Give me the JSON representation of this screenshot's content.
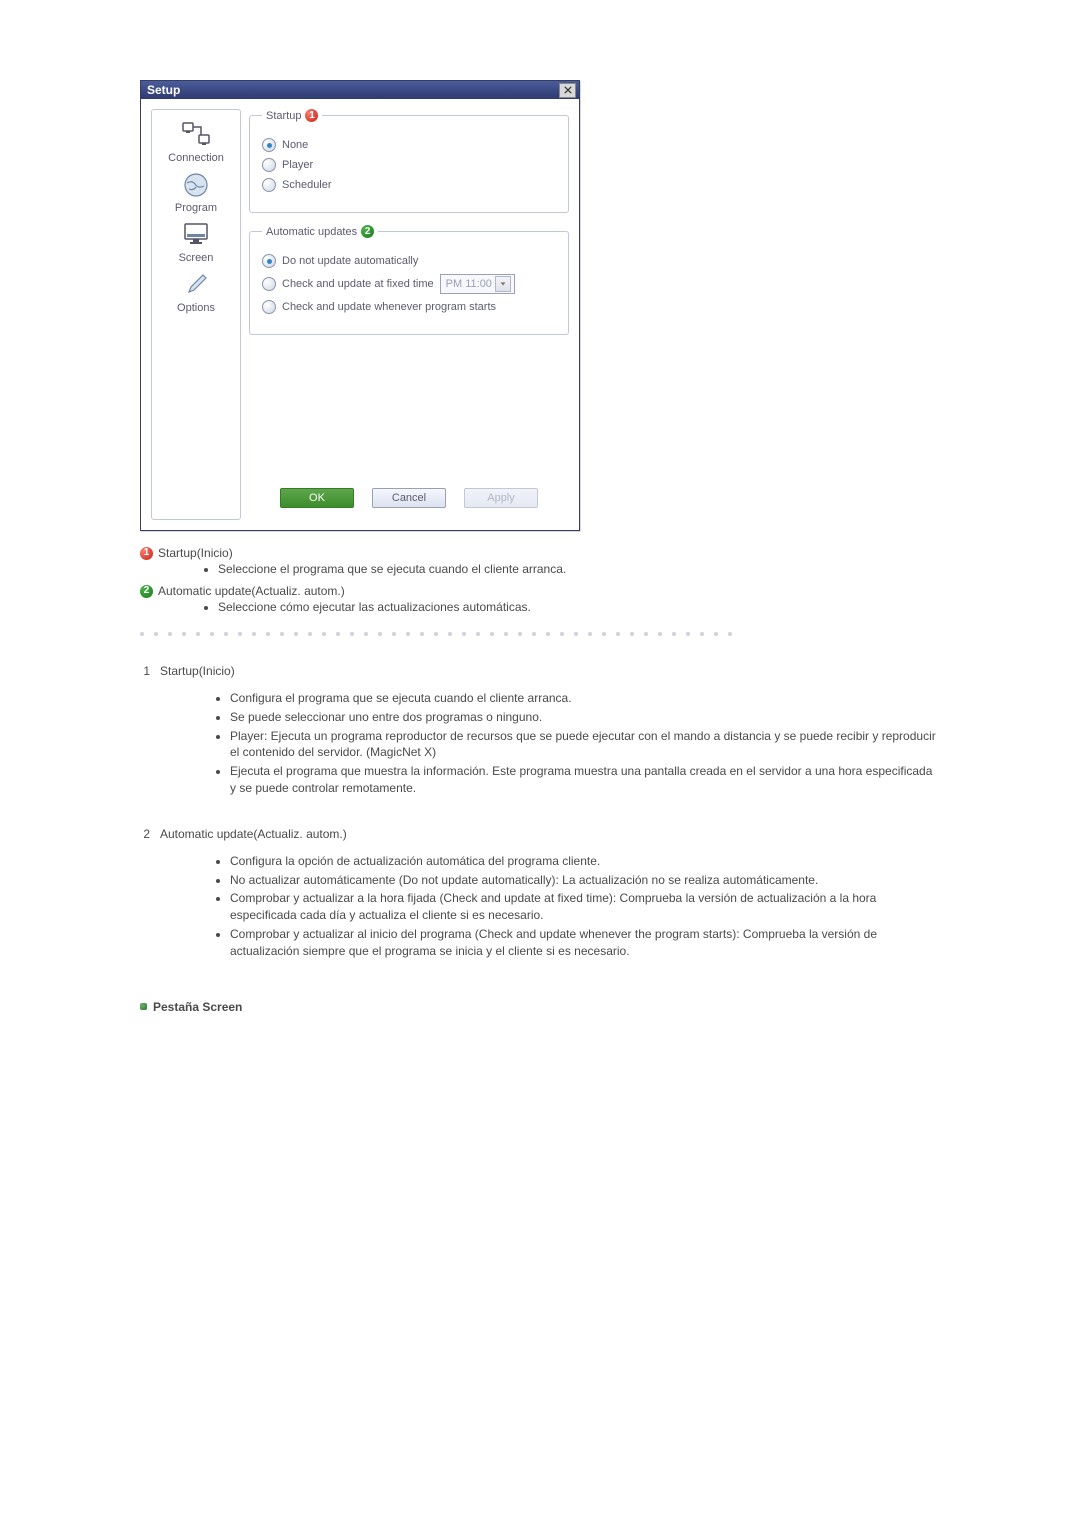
{
  "dialog": {
    "title": "Setup",
    "nav": {
      "connection": "Connection",
      "program": "Program",
      "screen": "Screen",
      "options": "Options"
    },
    "startup_group": {
      "legend": "Startup",
      "opt_none": "None",
      "opt_player": "Player",
      "opt_scheduler": "Scheduler"
    },
    "updates_group": {
      "legend": "Automatic updates",
      "opt_noauto": "Do not update automatically",
      "opt_fixed": "Check and update at fixed time",
      "opt_starts": "Check and update whenever program starts",
      "time_value": "PM 11:00"
    },
    "buttons": {
      "ok": "OK",
      "cancel": "Cancel",
      "apply": "Apply"
    }
  },
  "captions": {
    "startup_title": "Startup(Inicio)",
    "startup_desc": "Seleccione el programa que se ejecuta cuando el cliente arranca.",
    "updates_title": "Automatic update(Actualiz. autom.)",
    "updates_desc": "Seleccione cómo ejecutar las actualizaciones automáticas."
  },
  "details": {
    "startup_num": "1",
    "startup_title": "Startup(Inicio)",
    "startup_items": [
      "Configura el programa que se ejecuta cuando el cliente arranca.",
      "Se puede seleccionar uno entre dos programas o ninguno.",
      "Player: Ejecuta un programa reproductor de recursos que se puede ejecutar con el mando a distancia y se puede recibir y reproducir el contenido del servidor. (MagicNet X)",
      "Ejecuta el programa que muestra la información. Este programa muestra una pantalla creada en el servidor a una hora especificada y se puede controlar remotamente."
    ],
    "updates_num": "2",
    "updates_title": "Automatic update(Actualiz. autom.)",
    "updates_items": [
      "Configura la opción de actualización automática del programa cliente.",
      "No actualizar automáticamente (Do not update automatically): La actualización no se realiza automáticamente.",
      "Comprobar y actualizar a la hora fijada (Check and update at fixed time): Comprueba la versión de actualización a la hora especificada cada día y actualiza el cliente si es necesario.",
      "Comprobar y actualizar al inicio del programa (Check and update whenever the program starts): Comprueba la versión de actualización siempre que el programa se inicia y el cliente si es necesario."
    ]
  },
  "section_screen_title": "Pestaña Screen",
  "numbers": {
    "one": "1",
    "two": "2"
  }
}
